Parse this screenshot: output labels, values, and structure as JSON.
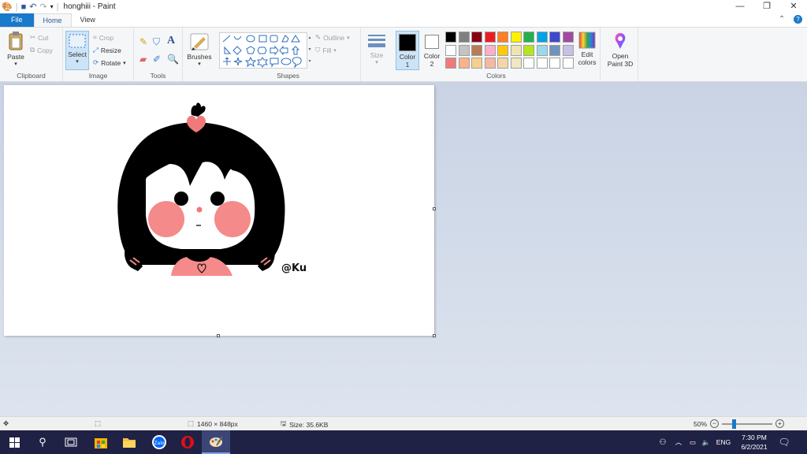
{
  "title": "honghiii - Paint",
  "tabs": [
    {
      "label": "File"
    },
    {
      "label": "Home"
    },
    {
      "label": "View"
    }
  ],
  "clipboard": {
    "paste": "Paste",
    "cut": "Cut",
    "copy": "Copy",
    "label": "Clipboard"
  },
  "image": {
    "select": "Select",
    "crop": "Crop",
    "resize": "Resize",
    "rotate": "Rotate",
    "label": "Image"
  },
  "tools": {
    "label": "Tools"
  },
  "brushes": {
    "label": "Brushes"
  },
  "shapes": {
    "outline": "Outline",
    "fill": "Fill",
    "label": "Shapes"
  },
  "size": {
    "label": "Size"
  },
  "colors": {
    "color1": "Color",
    "color1_num": "1",
    "color2": "Color",
    "color2_num": "2",
    "edit": "Edit",
    "edit2": "colors",
    "label": "Colors",
    "row1": [
      "#000000",
      "#7f7f7f",
      "#880015",
      "#ed1c24",
      "#ff7f27",
      "#fff200",
      "#22b14c",
      "#00a2e8",
      "#3f48cc",
      "#a349a4"
    ],
    "row2": [
      "#ffffff",
      "#c3c3c3",
      "#b97a57",
      "#ffaec9",
      "#ffc90e",
      "#efe4b0",
      "#b5e61d",
      "#99d9ea",
      "#7092be",
      "#c8bfe7"
    ],
    "row3": [
      "#f07a7a",
      "#f5b48a",
      "#f5d08a",
      "#f5b8a0",
      "#f5d6a8",
      "#f0e8c0",
      "#ffffff",
      "#ffffff",
      "#ffffff",
      "#ffffff"
    ]
  },
  "paint3d": {
    "line1": "Open",
    "line2": "Paint 3D"
  },
  "canvas_text": {
    "watermark": "@Ku"
  },
  "status": {
    "dimensions": "1460 × 848px",
    "size": "Size: 35.6KB",
    "zoom": "50%"
  },
  "zoom_level": 0.5,
  "clock": {
    "time": "7:30 PM",
    "date": "6/2/2021"
  },
  "lang": "ENG"
}
